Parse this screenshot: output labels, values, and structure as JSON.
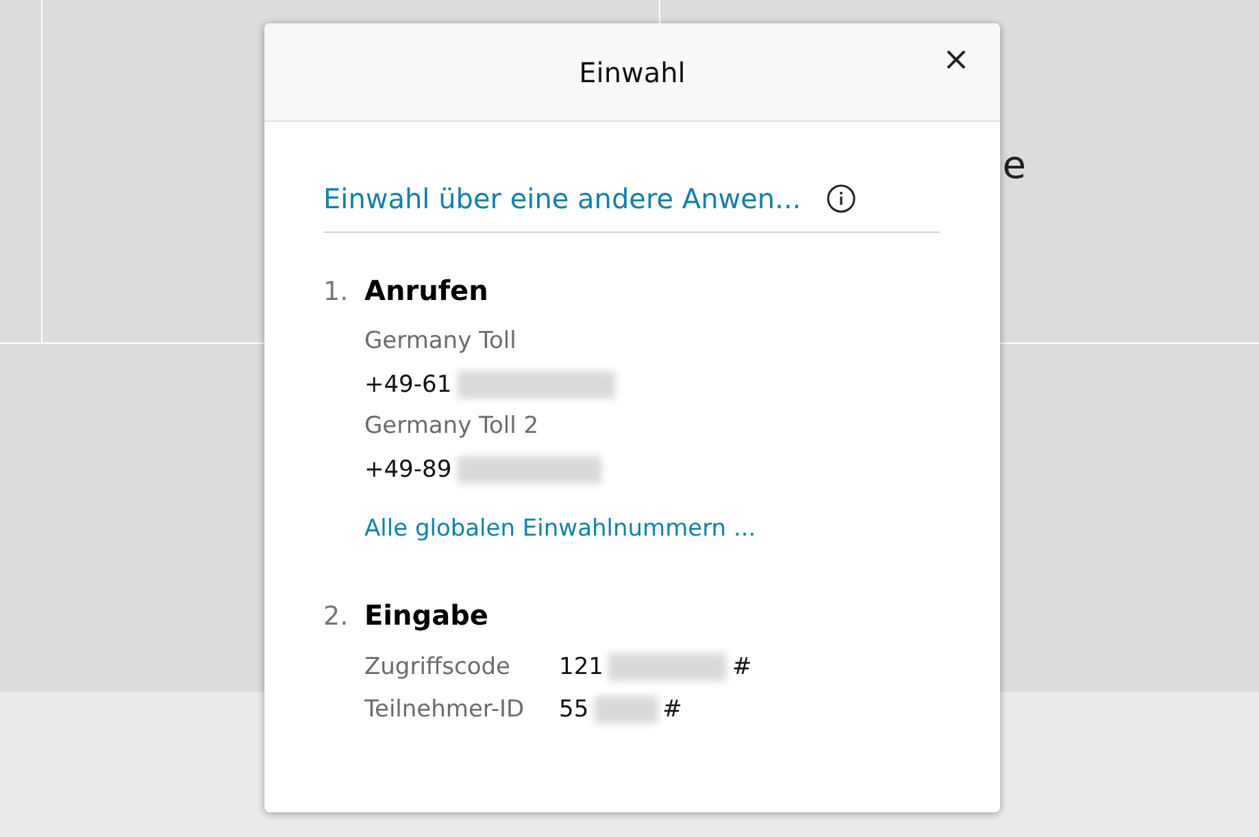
{
  "background": {
    "partial_text": "e"
  },
  "dialog": {
    "title": "Einwahl",
    "close": "×",
    "app_link": "Einwahl über eine andere Anwen...",
    "steps": [
      {
        "number": "1.",
        "title": "Anrufen",
        "kind": "phones",
        "numbers": [
          {
            "label": "Germany Toll",
            "value": "+49-61",
            "redacted": true
          },
          {
            "label": "Germany Toll 2",
            "value": "+49-89",
            "redacted": true
          }
        ],
        "link": "Alle globalen Einwahlnummern ..."
      },
      {
        "number": "2.",
        "title": "Eingabe",
        "kind": "codes",
        "codes": [
          {
            "label": "Zugriffscode",
            "value": "121",
            "redacted": true,
            "suffix": "#"
          },
          {
            "label": "Teilnehmer-ID",
            "value": "55",
            "redacted": true,
            "suffix": "#"
          }
        ]
      }
    ]
  }
}
